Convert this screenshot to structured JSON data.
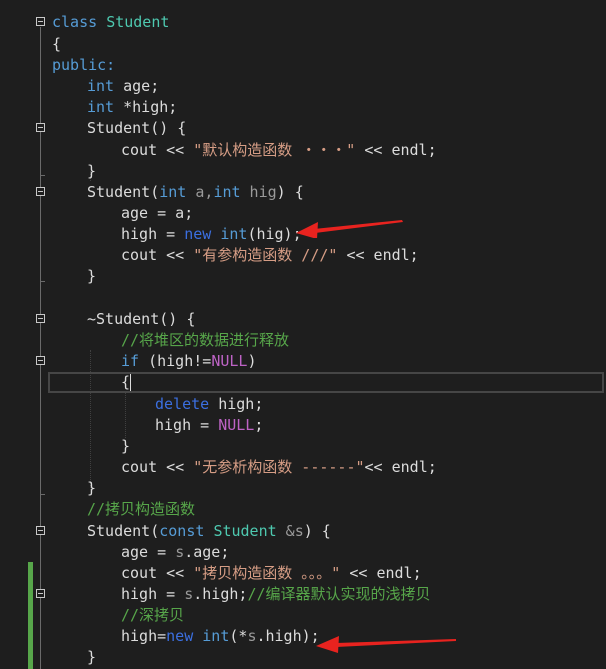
{
  "code": {
    "l1_kw": "class",
    "l1_name": "Student",
    "l2": "{",
    "l3": "public:",
    "l4_type": "int",
    "l4_rest": " age;",
    "l5_type": "int",
    "l5_rest": " *high;",
    "l6": "Student() {",
    "l7_a": "cout << ",
    "l7_str": "\"默认构造函数 ・・・\"",
    "l7_b": " << endl;",
    "l8": "}",
    "l9_a": "Student(",
    "l9_t1": "int",
    "l9_p1": " a,",
    "l9_t2": "int",
    "l9_p2": " hig",
    "l9_b": ") {",
    "l10": "age = a;",
    "l11_a": "high = ",
    "l11_new": "new",
    "l11_sp": " ",
    "l11_int": "int",
    "l11_b": "(hig);",
    "l12_a": "cout << ",
    "l12_str": "\"有参构造函数 ///\"",
    "l12_b": " << endl;",
    "l13": "}",
    "l14": "~Student() {",
    "l15": "//将堆区的数据进行释放",
    "l16_if": "if",
    "l16_a": " (high!=",
    "l16_null": "NULL",
    "l16_b": ")",
    "l17": "{",
    "l18_del": "delete",
    "l18_b": " high;",
    "l19_a": "high = ",
    "l19_null": "NULL",
    "l19_b": ";",
    "l20": "}",
    "l21_a": "cout << ",
    "l21_str": "\"无参析构函数 ------\"",
    "l21_b": "<< endl;",
    "l22": "}",
    "l23": "//拷贝构造函数",
    "l24_a": "Student(",
    "l24_const": "const",
    "l24_sp": " ",
    "l24_type": "Student",
    "l24_p": " &s",
    "l24_b": ") {",
    "l25_a": "age = ",
    "l25_s": "s",
    "l25_b": ".age;",
    "l26_a": "cout << ",
    "l26_str": "\"拷贝构造函数 。。。\"",
    "l26_b": " << endl;",
    "l27_a": "high = ",
    "l27_s": "s",
    "l27_b": ".high;",
    "l27_cm": "//编译器默认实现的浅拷贝",
    "l28": "//深拷贝",
    "l29_a": "high=",
    "l29_new": "new",
    "l29_sp": " ",
    "l29_int": "int",
    "l29_b": "(*",
    "l29_s": "s",
    "l29_c": ".high);",
    "l30": "}"
  },
  "colors": {
    "background": "#1e1e1e",
    "keyword": "#569cd6",
    "type": "#4ec9b0",
    "string": "#d69d85",
    "comment": "#57a64a",
    "macro": "#bd63c5",
    "arrow": "#e8231f"
  },
  "icons": {
    "fold": "minus-box-icon",
    "arrow": "red-arrow-icon"
  }
}
